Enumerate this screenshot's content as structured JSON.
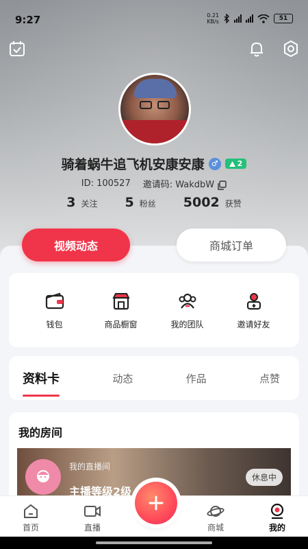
{
  "status_bar": {
    "time": "9:27",
    "net_speed_value": "0.21",
    "net_speed_unit": "KB/s",
    "battery": "51"
  },
  "profile": {
    "username": "骑着蜗牛追飞机安康安康",
    "gender_symbol": "♂",
    "level": "2",
    "id_text": "ID: 100527",
    "invite_text": "邀请码: WakdbW",
    "stats": [
      {
        "value": "3",
        "label": "关注"
      },
      {
        "value": "5",
        "label": "粉丝"
      },
      {
        "value": "5002",
        "label": "获赞"
      }
    ]
  },
  "main_tabs": {
    "video": "视频动态",
    "orders": "商城订单"
  },
  "quick_actions": [
    {
      "label": "钱包",
      "icon": "wallet-icon"
    },
    {
      "label": "商品橱窗",
      "icon": "storefront-icon"
    },
    {
      "label": "我的团队",
      "icon": "team-icon"
    },
    {
      "label": "邀请好友",
      "icon": "invite-user-icon"
    }
  ],
  "sub_tabs": [
    "资料卡",
    "动态",
    "作品",
    "点赞"
  ],
  "room": {
    "title": "我的房间",
    "subtitle": "我的直播间",
    "level": "主播等级2级",
    "status": "休息中"
  },
  "bottom_nav": [
    {
      "label": "首页",
      "icon": "home-icon"
    },
    {
      "label": "直播",
      "icon": "camera-icon"
    },
    {
      "label": "商城",
      "icon": "planet-icon"
    },
    {
      "label": "我的",
      "icon": "profile-icon"
    }
  ],
  "colors": {
    "accent": "#f0354a",
    "level_badge": "#24c07a",
    "gender_badge": "#5b8fdc"
  }
}
